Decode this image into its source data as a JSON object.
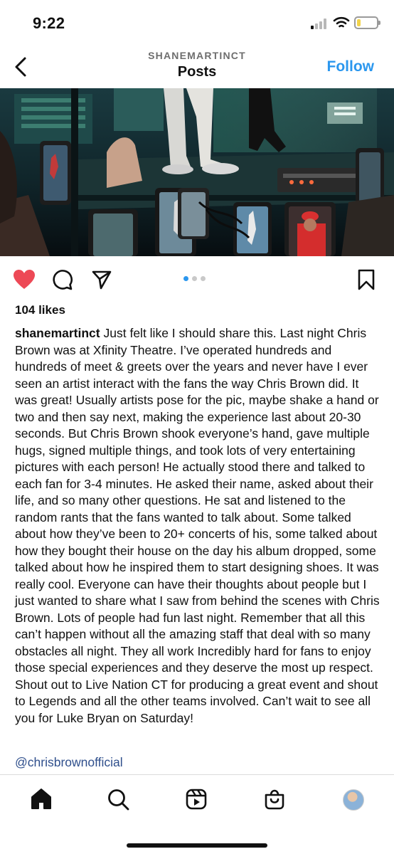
{
  "status_bar": {
    "time": "9:22",
    "battery_level": 0.2,
    "battery_color": "#f2d34a"
  },
  "header": {
    "username": "SHANEMARTINCT",
    "title": "Posts",
    "follow_label": "Follow",
    "follow_color": "#2b97ee"
  },
  "post": {
    "image_icon": "concert-photo",
    "carousel": {
      "count": 3,
      "active_index": 0
    },
    "liked": true,
    "like_color": "#ed4956",
    "likes": "104 likes",
    "caption_user": "shanemartinct",
    "caption_text": "Just felt like I should share this. Last night Chris Brown was at Xfinity Theatre. I’ve operated hundreds and hundreds of meet & greets over the years and never have I ever seen an artist interact with the fans the way Chris Brown did. It was great! Usually artists pose for the pic, maybe shake a hand or two and then say next, making the experience last about 20-30 seconds. But Chris Brown shook everyone’s hand, gave multiple hugs, signed multiple things, and took lots of very entertaining pictures with each person! He actually stood there and talked to each fan for 3-4 minutes. He asked their name, asked about their life, and so many other questions. He sat and listened to the random rants that the fans wanted to talk about. Some talked about how they’ve been to 20+ concerts of his, some talked about how they bought their house on the day his album dropped, some talked about how he inspired them to start designing shoes. It was really cool. Everyone can have their thoughts about people but I just wanted to share what I saw from behind the scenes with Chris Brown. Lots of people had fun last night. Remember that all this can’t happen without all the amazing staff that deal with so many obstacles all night. They all work Incredibly hard for fans to enjoy those special experiences and they deserve the most up respect. Shout out to Live Nation CT for producing a great event and shout to Legends and all the other teams involved. Can’t wait to see all you for Luke Bryan on Saturday!",
    "mention": "@chrisbrownofficial",
    "mention_color": "#2f4f8c"
  },
  "actions": {
    "icons": [
      "heart-icon",
      "comment-icon",
      "share-icon",
      "bookmark-icon"
    ]
  },
  "bottom_nav": {
    "icons": [
      "home-icon",
      "search-icon",
      "reels-icon",
      "shop-icon",
      "profile-avatar"
    ]
  }
}
